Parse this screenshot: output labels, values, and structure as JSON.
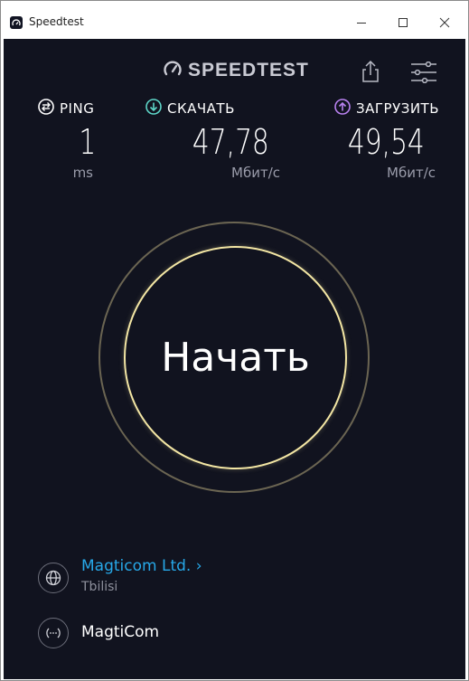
{
  "window": {
    "title": "Speedtest"
  },
  "header": {
    "logo_text": "SPEEDTEST"
  },
  "metrics": {
    "ping": {
      "label": "PING",
      "value": "1",
      "unit": "ms"
    },
    "download": {
      "label": "СКАЧАТЬ",
      "value": "47,78",
      "unit": "Мбит/с"
    },
    "upload": {
      "label": "ЗАГРУЗИТЬ",
      "value": "49,54",
      "unit": "Мбит/с"
    }
  },
  "go_button": {
    "label": "Начать"
  },
  "provider": {
    "name": "Magticom Ltd.",
    "chevron": "›",
    "location": "Tbilisi"
  },
  "server": {
    "name": "MagtiCom"
  },
  "colors": {
    "background": "#11131f",
    "ping_icon": "#ffffff",
    "download_icon": "#5ed6c8",
    "upload_icon": "#b982f0",
    "link": "#27a8e8",
    "ring_inner": "#f3e6a4",
    "ring_outer": "#6b6552"
  },
  "icons": {
    "app": "speedtest-app-icon",
    "minimize": "minimize-icon",
    "maximize": "maximize-icon",
    "close": "close-icon",
    "logo": "speedometer-icon",
    "share": "share-icon",
    "settings": "settings-sliders-icon",
    "ping": "ping-icon",
    "download": "download-arrow-icon",
    "upload": "upload-arrow-icon",
    "provider": "globe-icon",
    "server": "server-icon"
  }
}
